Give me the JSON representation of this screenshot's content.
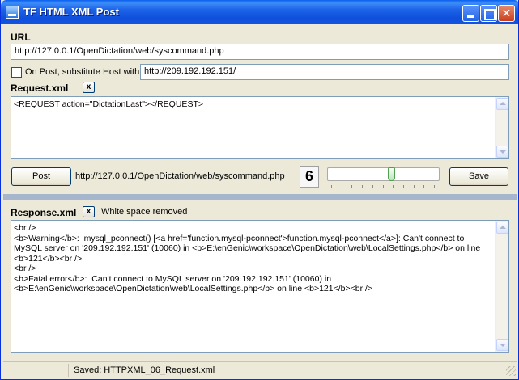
{
  "window": {
    "title": "TF HTML XML Post"
  },
  "url": {
    "label": "URL",
    "value": "http://127.0.0.1/OpenDictation/web/syscommand.php"
  },
  "substitute": {
    "checkbox_label": "On Post, substitute Host with",
    "checked": false,
    "host_value": "http://209.192.192.151/"
  },
  "request": {
    "label": "Request.xml",
    "clear_label": "x",
    "body": "<REQUEST action=\"DictationLast\"></REQUEST>"
  },
  "action_row": {
    "post_label": "Post",
    "post_url": "http://127.0.0.1/OpenDictation/web/syscommand.php",
    "count": "6",
    "slider_level_percent": 58,
    "save_label": "Save"
  },
  "response": {
    "label": "Response.xml",
    "clear_label": "x",
    "note": "White space removed",
    "body": "<br />\n<b>Warning</b>:  mysql_pconnect() [<a href='function.mysql-pconnect'>function.mysql-pconnect</a>]: Can't connect to MySQL server on '209.192.192.151' (10060) in <b>E:\\enGenic\\workspace\\OpenDictation\\web\\LocalSettings.php</b> on line <b>121</b><br />\n<br />\n<b>Fatal error</b>:  Can't connect to MySQL server on '209.192.192.151' (10060) in <b>E:\\enGenic\\workspace\\OpenDictation\\web\\LocalSettings.php</b> on line <b>121</b><br />"
  },
  "status": {
    "text": "Saved: HTTPXML_06_Request.xml"
  },
  "icons": {
    "app": "app-window-icon",
    "minimize": "minimize-icon",
    "maximize": "maximize-icon",
    "close": "close-icon"
  }
}
